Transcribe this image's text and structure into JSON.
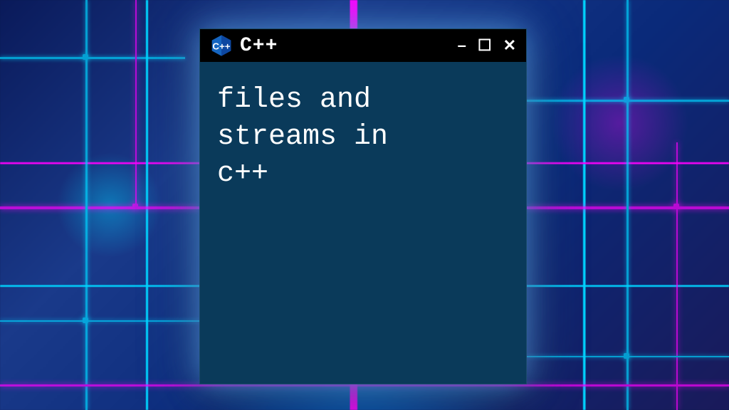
{
  "window": {
    "title": "C++",
    "icon_name": "cpp-icon",
    "controls": {
      "minimize": "–",
      "maximize": "☐",
      "close": "✕"
    }
  },
  "content": {
    "text": "files and\nstreams in\nc++"
  },
  "colors": {
    "window_bg": "#0a3a5a",
    "titlebar_bg": "#000000",
    "text": "#ffffff",
    "glow": "#64b4ff",
    "circuit_cyan": "#00d4ff",
    "circuit_magenta": "#ff00ff"
  }
}
